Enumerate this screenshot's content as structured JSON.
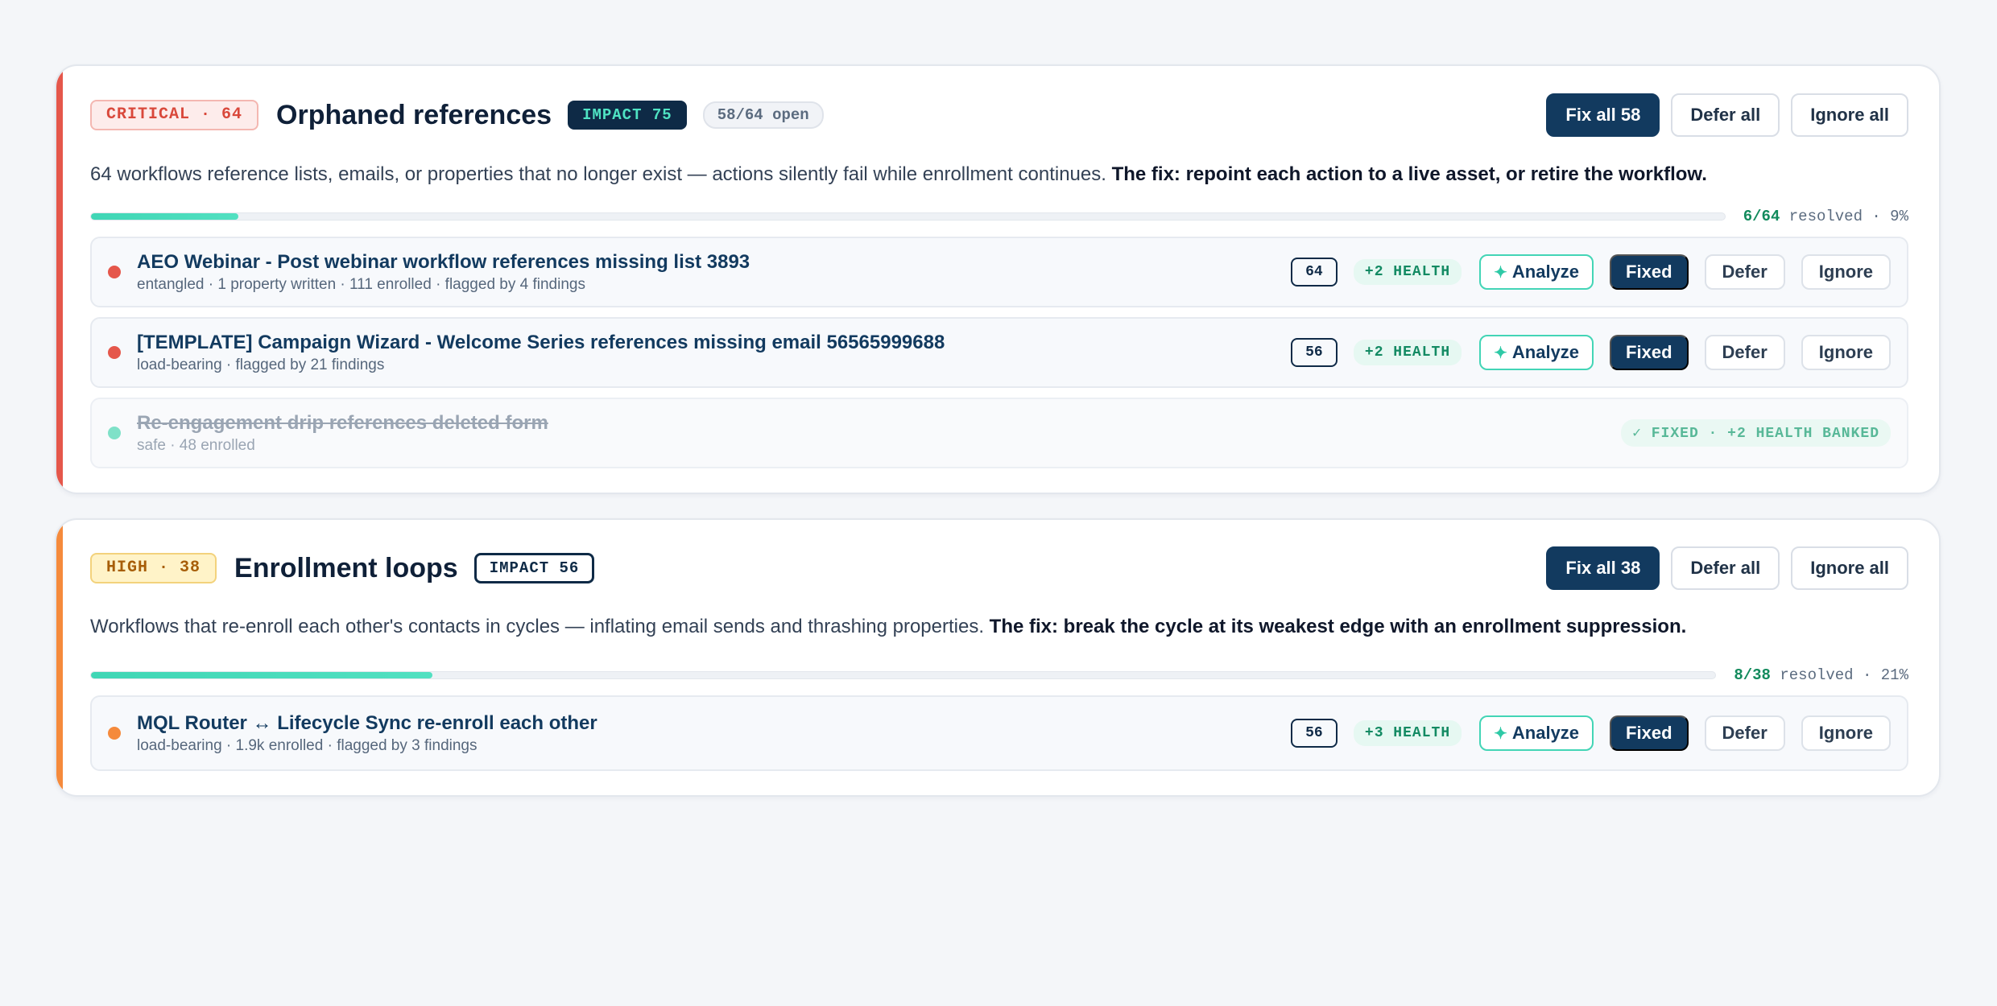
{
  "groups": [
    {
      "severity_label": "CRITICAL · 64",
      "title": "Orphaned references",
      "impact_label": "IMPACT 75",
      "open_label": "58/64 open",
      "fix_all_label": "Fix all 58",
      "defer_all_label": "Defer all",
      "ignore_all_label": "Ignore all",
      "description": "64 workflows reference lists, emails, or properties that no longer exist — actions silently fail while enrollment continues.",
      "fix_text": "The fix: repoint each action to a live asset, or retire the workflow.",
      "progress": {
        "resolved": "6/64",
        "suffix": "resolved · 9%",
        "fraction": 0.09
      },
      "accent_color": "#e5574b",
      "items": [
        {
          "title": "AEO Webinar - Post webinar workflow references missing list 3893",
          "meta": "entangled · 1 property written · 111 enrolled · flagged by 4 findings",
          "score": "64",
          "health": "+2 HEALTH",
          "analyze_label": "Analyze",
          "fixed_label": "Fixed",
          "defer_label": "Defer",
          "ignore_label": "Ignore",
          "dot_color": "#e5574b"
        },
        {
          "title": "[TEMPLATE] Campaign Wizard - Welcome Series references missing email 56565999688",
          "meta": "load-bearing · flagged by 21 findings",
          "score": "56",
          "health": "+2 HEALTH",
          "analyze_label": "Analyze",
          "fixed_label": "Fixed",
          "defer_label": "Defer",
          "ignore_label": "Ignore",
          "dot_color": "#e5574b"
        }
      ],
      "fixed_item": {
        "title": "Re-engagement drip references deleted form",
        "meta": "safe · 48 enrolled",
        "status": "✓ FIXED · +2 HEALTH BANKED",
        "dot_color": "#7fe1c8"
      }
    },
    {
      "severity_label": "HIGH · 38",
      "title": "Enrollment loops",
      "impact_label": "IMPACT 56",
      "fix_all_label": "Fix all 38",
      "defer_all_label": "Defer all",
      "ignore_all_label": "Ignore all",
      "description": "Workflows that re-enroll each other's contacts in cycles — inflating email sends and thrashing properties.",
      "fix_text": "The fix: break the cycle at its weakest edge with an enrollment suppression.",
      "progress": {
        "resolved": "8/38",
        "suffix": "resolved · 21%",
        "fraction": 0.21
      },
      "accent_color": "#f58a3c",
      "items": [
        {
          "title": "MQL Router ↔ Lifecycle Sync re-enroll each other",
          "meta": "load-bearing · 1.9k enrolled · flagged by 3 findings",
          "score": "56",
          "health": "+3 HEALTH",
          "analyze_label": "Analyze",
          "fixed_label": "Fixed",
          "defer_label": "Defer",
          "ignore_label": "Ignore",
          "dot_color": "#f58a3c"
        }
      ]
    }
  ]
}
